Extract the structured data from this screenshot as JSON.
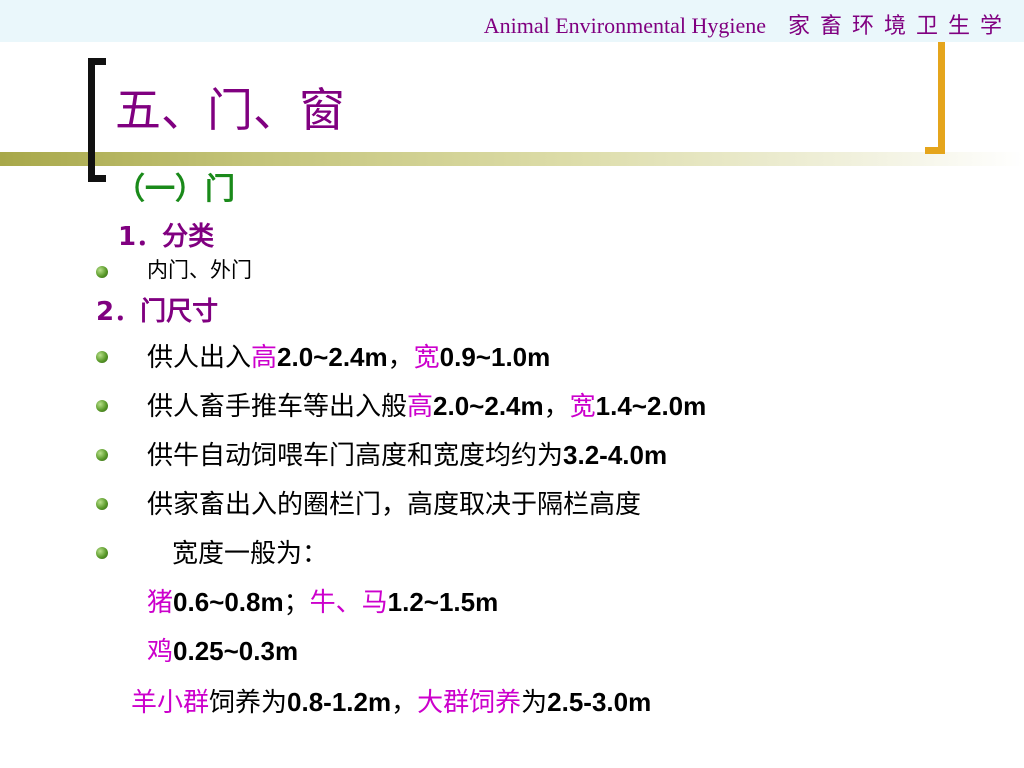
{
  "header": {
    "en": "Animal Environmental Hygiene",
    "cn": "家畜环境卫生学"
  },
  "title": "五、门、窗",
  "subtitle": "（一）门",
  "section1": {
    "label": "1．分类",
    "items": [
      "内门、外门"
    ]
  },
  "section2": {
    "label": "2．门尺寸"
  },
  "lines": [
    {
      "p1": "供人出入",
      "p2": "高",
      "p3": "2.0~2.4m",
      "p4": "，",
      "p5": "宽",
      "p6": "0.9~1.0m"
    },
    {
      "p1": "供人畜手推车等出入般",
      "p2": "高",
      "p3": "2.0~2.4m",
      "p4": "，",
      "p5": "宽",
      "p6": "1.4~2.0m"
    },
    {
      "p1": "供牛自动饲喂车门高度和宽度均约为",
      "p3": "3.2-4.0m"
    },
    {
      "p1": "供家畜出入的圈栏门，高度取决于隔栏高度"
    },
    {
      "p1": "宽度一般为："
    },
    {
      "p2": "猪",
      "p3": "0.6~0.8m",
      "p4": "；",
      "p5": "牛、马",
      "p6": "1.2~1.5m"
    },
    {
      "p2": "鸡",
      "p3": "0.25~0.3m"
    },
    {
      "p2": "羊小群",
      "p1": "饲养为",
      "p3": "0.8-1.2m",
      "p4": "，",
      "p5": "大群饲养",
      "p7": "为",
      "p6": "2.5-3.0m"
    }
  ],
  "colors": {
    "title": "#800080",
    "subtitle": "#1a8a1a",
    "highlight": "#cc00cc",
    "bracket_right": "#e5a51c"
  }
}
